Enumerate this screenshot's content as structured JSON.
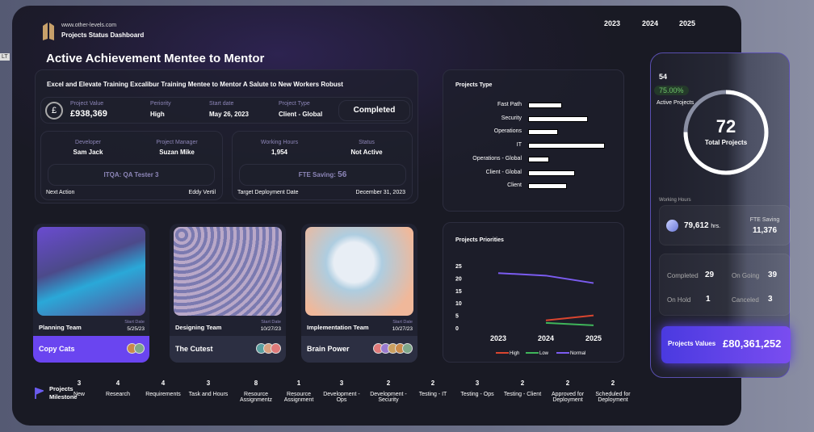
{
  "corner_tag": "LT",
  "header": {
    "site": "www.other-levels.com",
    "app_title": "Projects Status Dashboard",
    "years": [
      "2023",
      "2024",
      "2025"
    ]
  },
  "page_title": "Active Achievement Mentee to Mentor",
  "project": {
    "name": "Excel and Elevate Training Excalibur Training Mentee to Mentor A Salute to New Workers Robust",
    "value_label": "Project Value",
    "value": "£938,369",
    "priority_label": "Periority",
    "priority": "High",
    "start_label": "Start date",
    "start": "May 26, 2023",
    "type_label": "Project Type",
    "type": "Client - Global",
    "state": "Completed",
    "developer_label": "Developer",
    "developer": "Sam Jack",
    "manager_label": "Project Manager",
    "manager": "Suzan Mike",
    "itqa": "ITQA: QA Tester 3",
    "next_action_label": "Next Action",
    "next_action": "Eddy Vertil",
    "hours_label": "Working Hours",
    "hours": "1,954",
    "status_label": "Status",
    "status": "Not Active",
    "fte_label": "FTE Saving:",
    "fte": "56",
    "target_label": "Target Deployment Date",
    "target": "December 31, 2023"
  },
  "projects_type": {
    "title": "Projects Type"
  },
  "projects_priorities": {
    "title": "Projects Priorities"
  },
  "chart_data": [
    {
      "type": "bar",
      "orientation": "horizontal",
      "title": "Projects Type",
      "categories": [
        "Fast Path",
        "Security",
        "Operations",
        "IT",
        "Operations - Global",
        "Client - Global",
        "Client"
      ],
      "values": [
        8,
        14,
        7,
        18,
        5,
        11,
        9
      ],
      "color": "#ffffff"
    },
    {
      "type": "line",
      "title": "Projects Priorities",
      "categories": [
        "2023",
        "2024",
        "2025"
      ],
      "ylim": [
        0,
        25
      ],
      "yticks": [
        0,
        5,
        10,
        15,
        20,
        25
      ],
      "legend": "bottom",
      "series": [
        {
          "name": "High",
          "values": [
            null,
            3,
            5
          ],
          "color": "#d9452f"
        },
        {
          "name": "Low",
          "values": [
            null,
            2,
            1
          ],
          "color": "#3fb55a"
        },
        {
          "name": "Normal",
          "values": [
            22,
            21,
            18
          ],
          "color": "#7b5cf0"
        }
      ]
    }
  ],
  "teams": [
    {
      "name": "Planning Team",
      "start_label": "Start Date",
      "start": "5/25/23",
      "group": "Copy Cats",
      "avatars": 2
    },
    {
      "name": "Designing Team",
      "start_label": "Start Date",
      "start": "10/27/23",
      "group": "The Cutest",
      "avatars": 3
    },
    {
      "name": "Implementation Team",
      "start_label": "Start Date",
      "start": "10/27/23",
      "group": "Brain Power",
      "avatars": 5
    }
  ],
  "milestone": {
    "title": "Projects Milestone",
    "items": [
      {
        "count": "3",
        "label": "New"
      },
      {
        "count": "4",
        "label": "Research"
      },
      {
        "count": "4",
        "label": "Requirements"
      },
      {
        "count": "3",
        "label": "Task and Hours"
      },
      {
        "count": "8",
        "label": "Resource Assignmentz"
      },
      {
        "count": "1",
        "label": "Resource Assignment"
      },
      {
        "count": "3",
        "label": "Development - Ops"
      },
      {
        "count": "2",
        "label": "Development - Security"
      },
      {
        "count": "2",
        "label": "Testing - IT"
      },
      {
        "count": "3",
        "label": "Testing - Ops"
      },
      {
        "count": "2",
        "label": "Testing - Client"
      },
      {
        "count": "2",
        "label": "Approved for Deployment"
      },
      {
        "count": "2",
        "label": "Scheduled for Deployment"
      }
    ]
  },
  "summary": {
    "active_count": "54",
    "active_pct": "75.00%",
    "active_pct_value": 75,
    "active_label": "Active Projects",
    "total": "72",
    "total_label": "Total Projects",
    "hours_section": "Working Hours",
    "hours": "79,612",
    "hours_unit": "hrs.",
    "fte_label": "FTE Saving",
    "fte": "11,376",
    "completed_label": "Completed",
    "completed": "29",
    "ongoing_label": "On Going",
    "ongoing": "39",
    "onhold_label": "On Hold",
    "onhold": "1",
    "canceled_label": "Canceled",
    "canceled": "3",
    "values_label": "Projects Values",
    "values": "£80,361,252"
  },
  "watermark": "www.other-levels.com"
}
